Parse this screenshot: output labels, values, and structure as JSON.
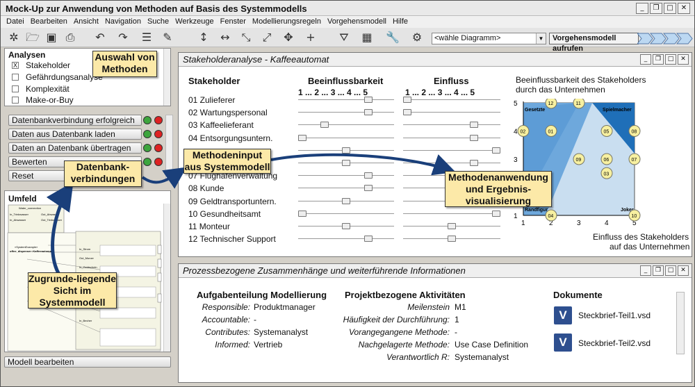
{
  "title": "Mock-Up zur Anwendung von Methoden auf Basis des Systemmodells",
  "menu": [
    "Datei",
    "Bearbeiten",
    "Ansicht",
    "Navigation",
    "Suche",
    "Werkzeuge",
    "Fenster",
    "Modellierungsregeln",
    "Vorgehensmodell",
    "Hilfe"
  ],
  "toolbar": {
    "diagram_select": "<wähle Diagramm>",
    "process_button": "Vorgehensmodell aufrufen"
  },
  "left": {
    "analysen_title": "Analysen",
    "analysen": [
      {
        "label": "Stakeholder",
        "checked": "X"
      },
      {
        "label": "Gefährdungsanalyse",
        "checked": ""
      },
      {
        "label": "Komplexität",
        "checked": ""
      },
      {
        "label": "Make-or-Buy",
        "checked": ""
      }
    ],
    "db_buttons": [
      "Datenbankverbindung erfolgreich",
      "Daten aus Datenbank laden",
      "Daten an Datenbank übertragen",
      "Bewerten",
      "Reset"
    ],
    "umfeld_title": "Umfeld",
    "model_button": "Modell bearbeiten",
    "diagram_texts": [
      "Water_connection",
      "In_Trinkwasser",
      "Out_Abwasser",
      "In_Abwasser",
      "Out_Trinkwasser",
      "«SystemExample»",
      "offee_dispenser::Kaffeeautomat",
      "In_Strom",
      "Out_Munze",
      "In_Geldschein",
      "Out_Kaffee",
      "In_Becher"
    ]
  },
  "callouts": {
    "auswahl": "Auswahl von Methoden",
    "datenbank": "Datenbank-verbindungen",
    "sicht": "Zugrunde-liegende Sicht im Systemmodell",
    "input": "Methodeninput aus Systemmodell",
    "anwendung": "Methodenanwendung und Ergebnis-visualisierung"
  },
  "stakeholder_window": {
    "title": "Stakeholderanalyse - Kaffeeautomat",
    "col_stakeholder": "Stakeholder",
    "col_beeinfluss": "Beeinflussbarkeit",
    "col_einfluss": "Einfluss",
    "scale": "1 ... 2 ... 3 ... 4 ... 5",
    "rows": [
      {
        "name": "01 Zulieferer",
        "b": 4,
        "e": 1
      },
      {
        "name": "02 Wartungspersonal",
        "b": 4,
        "e": 1
      },
      {
        "name": "03 Kaffeelieferant",
        "b": 2,
        "e": 4
      },
      {
        "name": "04 Entsorgungsuntern.",
        "b": 1,
        "e": 4
      },
      {
        "name": "05",
        "b": 3,
        "e": 5
      },
      {
        "name": "06",
        "b": 3,
        "e": 4
      },
      {
        "name": "07 Flughafenverwaltung",
        "b": 4,
        "e": 5
      },
      {
        "name": "08 Kunde",
        "b": 4,
        "e": 5
      },
      {
        "name": "09 Geldtransportuntern.",
        "b": 3,
        "e": 3
      },
      {
        "name": "10 Gesundheitsamt",
        "b": 1,
        "e": 5
      },
      {
        "name": "11 Monteur",
        "b": 3,
        "e": 3
      },
      {
        "name": "12 Technischer Support",
        "b": 4,
        "e": 3
      }
    ],
    "chart": {
      "ytitle_line1": "Beeinflussbarkeit des Stakeholders",
      "ytitle_line2": "durch das Unternehmen",
      "xtitle_line1": "Einfluss des Stakeholders",
      "xtitle_line2": "auf das Unternehmen",
      "quadrants": [
        "Gesetzte",
        "Spielmacher",
        "Randfigur",
        "Joker"
      ],
      "xticks": [
        "1",
        "2",
        "3",
        "4",
        "5"
      ],
      "yticks": [
        "1",
        "2",
        "3",
        "4",
        "5"
      ]
    }
  },
  "chart_data": {
    "type": "scatter",
    "x_label": "Einfluss des Stakeholders auf das Unternehmen",
    "y_label": "Beeinflussbarkeit des Stakeholders durch das Unternehmen",
    "xlim": [
      1,
      5
    ],
    "ylim": [
      1,
      5
    ],
    "points": [
      {
        "label": "01",
        "x": 2,
        "y": 4
      },
      {
        "label": "02",
        "x": 1,
        "y": 4
      },
      {
        "label": "03",
        "x": 4,
        "y": 2.5
      },
      {
        "label": "04",
        "x": 2,
        "y": 1
      },
      {
        "label": "05",
        "x": 4,
        "y": 4
      },
      {
        "label": "06",
        "x": 4,
        "y": 3
      },
      {
        "label": "07",
        "x": 5,
        "y": 3
      },
      {
        "label": "08",
        "x": 5,
        "y": 4
      },
      {
        "label": "09",
        "x": 3,
        "y": 3
      },
      {
        "label": "10",
        "x": 5,
        "y": 1
      },
      {
        "label": "11",
        "x": 3,
        "y": 5
      },
      {
        "label": "12",
        "x": 2,
        "y": 5
      }
    ]
  },
  "process_window": {
    "title": "Prozessbezogene Zusammenhänge und weiterführende Informationen",
    "aufgaben_title": "Aufgabenteilung Modellierung",
    "aufgaben": [
      {
        "k": "Responsible:",
        "v": "Produktmanager"
      },
      {
        "k": "Accountable:",
        "v": "-"
      },
      {
        "k": "Contributes:",
        "v": "Systemanalyst"
      },
      {
        "k": "Informed:",
        "v": "Vertrieb"
      }
    ],
    "aktiv_title": "Projektbezogene Aktivitäten",
    "aktiv": [
      {
        "k": "Meilenstein",
        "v": "M1"
      },
      {
        "k": "Häufigkeit der Durchführung:",
        "v": "1"
      },
      {
        "k": "Vorangegangene Methode:",
        "v": "-"
      },
      {
        "k": "Nachgelagerte Methode:",
        "v": "Use Case Definition"
      },
      {
        "k": "Verantwortlich R:",
        "v": "Systemanalyst"
      }
    ],
    "docs_title": "Dokumente",
    "docs": [
      "Steckbrief-Teil1.vsd",
      "Steckbrief-Teil2.vsd"
    ]
  }
}
